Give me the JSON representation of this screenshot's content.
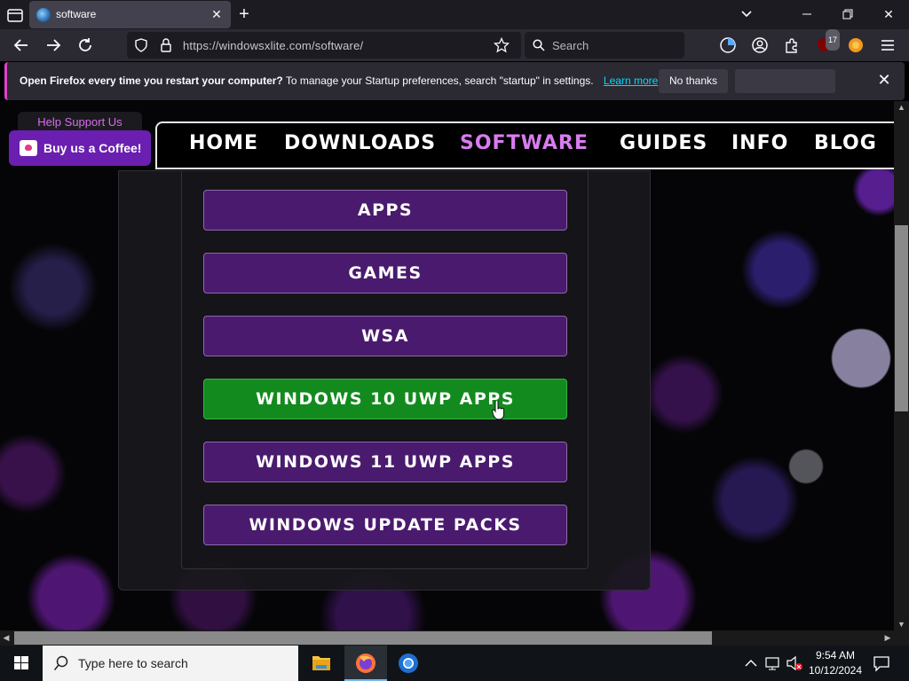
{
  "browser": {
    "tab_title": "software",
    "url": "https://windowsxlite.com/software/",
    "search_placeholder": "Search",
    "extension_badge": "17"
  },
  "notification": {
    "bold_text": "Open Firefox every time you restart your computer?",
    "text": "To manage your Startup preferences, search \"startup\" in settings.",
    "learn_more": "Learn more",
    "no_thanks": "No thanks"
  },
  "site": {
    "support_label": "Help Support Us",
    "coffee_label": "Buy us a Coffee!",
    "nav": [
      "HOME",
      "DOWNLOADS",
      "SOFTWARE",
      "GUIDES",
      "INFO",
      "BLOG"
    ],
    "active_nav": "SOFTWARE",
    "categories": [
      "APPS",
      "GAMES",
      "WSA",
      "WINDOWS 10 UWP APPS",
      "WINDOWS 11 UWP APPS",
      "WINDOWS UPDATE PACKS"
    ],
    "hovered_category": "WINDOWS 10 UWP APPS"
  },
  "taskbar": {
    "search_placeholder": "Type here to search",
    "time": "9:54 AM",
    "date": "10/12/2024"
  },
  "colors": {
    "accent_purple": "#4a1a6e",
    "hover_green": "#138a1e",
    "active_nav": "#d87cf0"
  }
}
